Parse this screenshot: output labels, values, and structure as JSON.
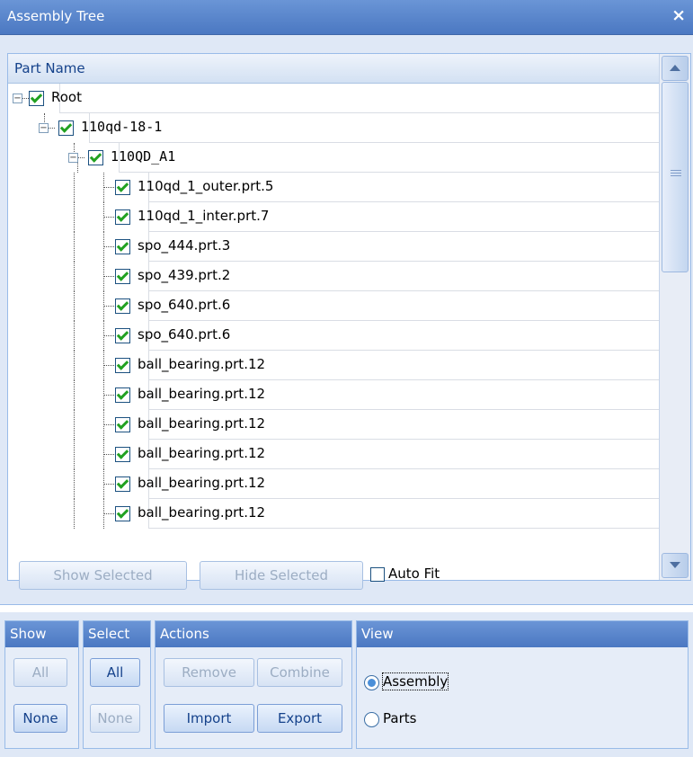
{
  "window": {
    "title": "Assembly Tree",
    "close_glyph": "×"
  },
  "grid": {
    "column_header": "Part Name"
  },
  "tree": [
    {
      "label": "Root",
      "level": 0,
      "expander": "minus"
    },
    {
      "label": "110qd-18-1",
      "level": 1,
      "expander": "minus"
    },
    {
      "label": "110QD_A1",
      "level": 2,
      "expander": "minus"
    },
    {
      "label": "110qd_1_outer.prt.5",
      "level": 3
    },
    {
      "label": "110qd_1_inter.prt.7",
      "level": 3
    },
    {
      "label": "spo_444.prt.3",
      "level": 3
    },
    {
      "label": "spo_439.prt.2",
      "level": 3
    },
    {
      "label": "spo_640.prt.6",
      "level": 3
    },
    {
      "label": "spo_640.prt.6",
      "level": 3
    },
    {
      "label": "ball_bearing.prt.12",
      "level": 3
    },
    {
      "label": "ball_bearing.prt.12",
      "level": 3
    },
    {
      "label": "ball_bearing.prt.12",
      "level": 3
    },
    {
      "label": "ball_bearing.prt.12",
      "level": 3
    },
    {
      "label": "ball_bearing.prt.12",
      "level": 3
    },
    {
      "label": "ball_bearing.prt.12",
      "level": 3
    }
  ],
  "toolbar": {
    "show_selected": "Show Selected",
    "hide_selected": "Hide Selected",
    "auto_fit": "Auto Fit"
  },
  "groups": {
    "show": {
      "title": "Show",
      "all": "All",
      "none": "None"
    },
    "select": {
      "title": "Select",
      "all": "All",
      "none": "None"
    },
    "actions": {
      "title": "Actions",
      "remove": "Remove",
      "combine": "Combine",
      "import": "Import",
      "export": "Export"
    },
    "view": {
      "title": "View",
      "assembly": "Assembly",
      "parts": "Parts",
      "selected": "Assembly"
    }
  },
  "colors": {
    "header_blue": "#4b78c2",
    "panel_bg": "#dfe8f6",
    "check_green": "#21a121"
  }
}
